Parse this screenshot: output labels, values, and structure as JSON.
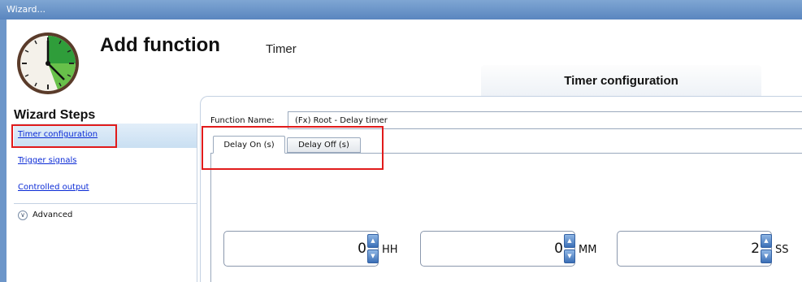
{
  "window": {
    "title": "Wizard..."
  },
  "header": {
    "title": "Add function",
    "subtitle": "Timer",
    "icon": "clock-icon"
  },
  "config_tab": {
    "label": "Timer configuration"
  },
  "wizard": {
    "title": "Wizard Steps",
    "steps": [
      {
        "label": "Timer configuration",
        "selected": true
      },
      {
        "label": "Trigger signals",
        "selected": false
      },
      {
        "label": "Controlled output",
        "selected": false
      }
    ],
    "advanced": {
      "label": "Advanced",
      "icon": "chevron-down-icon"
    }
  },
  "form": {
    "function_name_label": "Function Name:",
    "function_name_value": "(Fx) Root - Delay timer"
  },
  "tabs": [
    {
      "label": "Delay On (s)",
      "active": true
    },
    {
      "label": "Delay Off (s)",
      "active": false
    }
  ],
  "time": {
    "hours": {
      "value": "0",
      "unit": "HH"
    },
    "minutes": {
      "value": "0",
      "unit": "MM"
    },
    "seconds": {
      "value": "2",
      "unit": "SS"
    }
  },
  "colors": {
    "highlight": "#e11b1b",
    "link": "#0b2bd6",
    "titlebar": "#6d96c9",
    "selected_row": "#c9dff2",
    "spinner_button": "#3b6fb6"
  }
}
